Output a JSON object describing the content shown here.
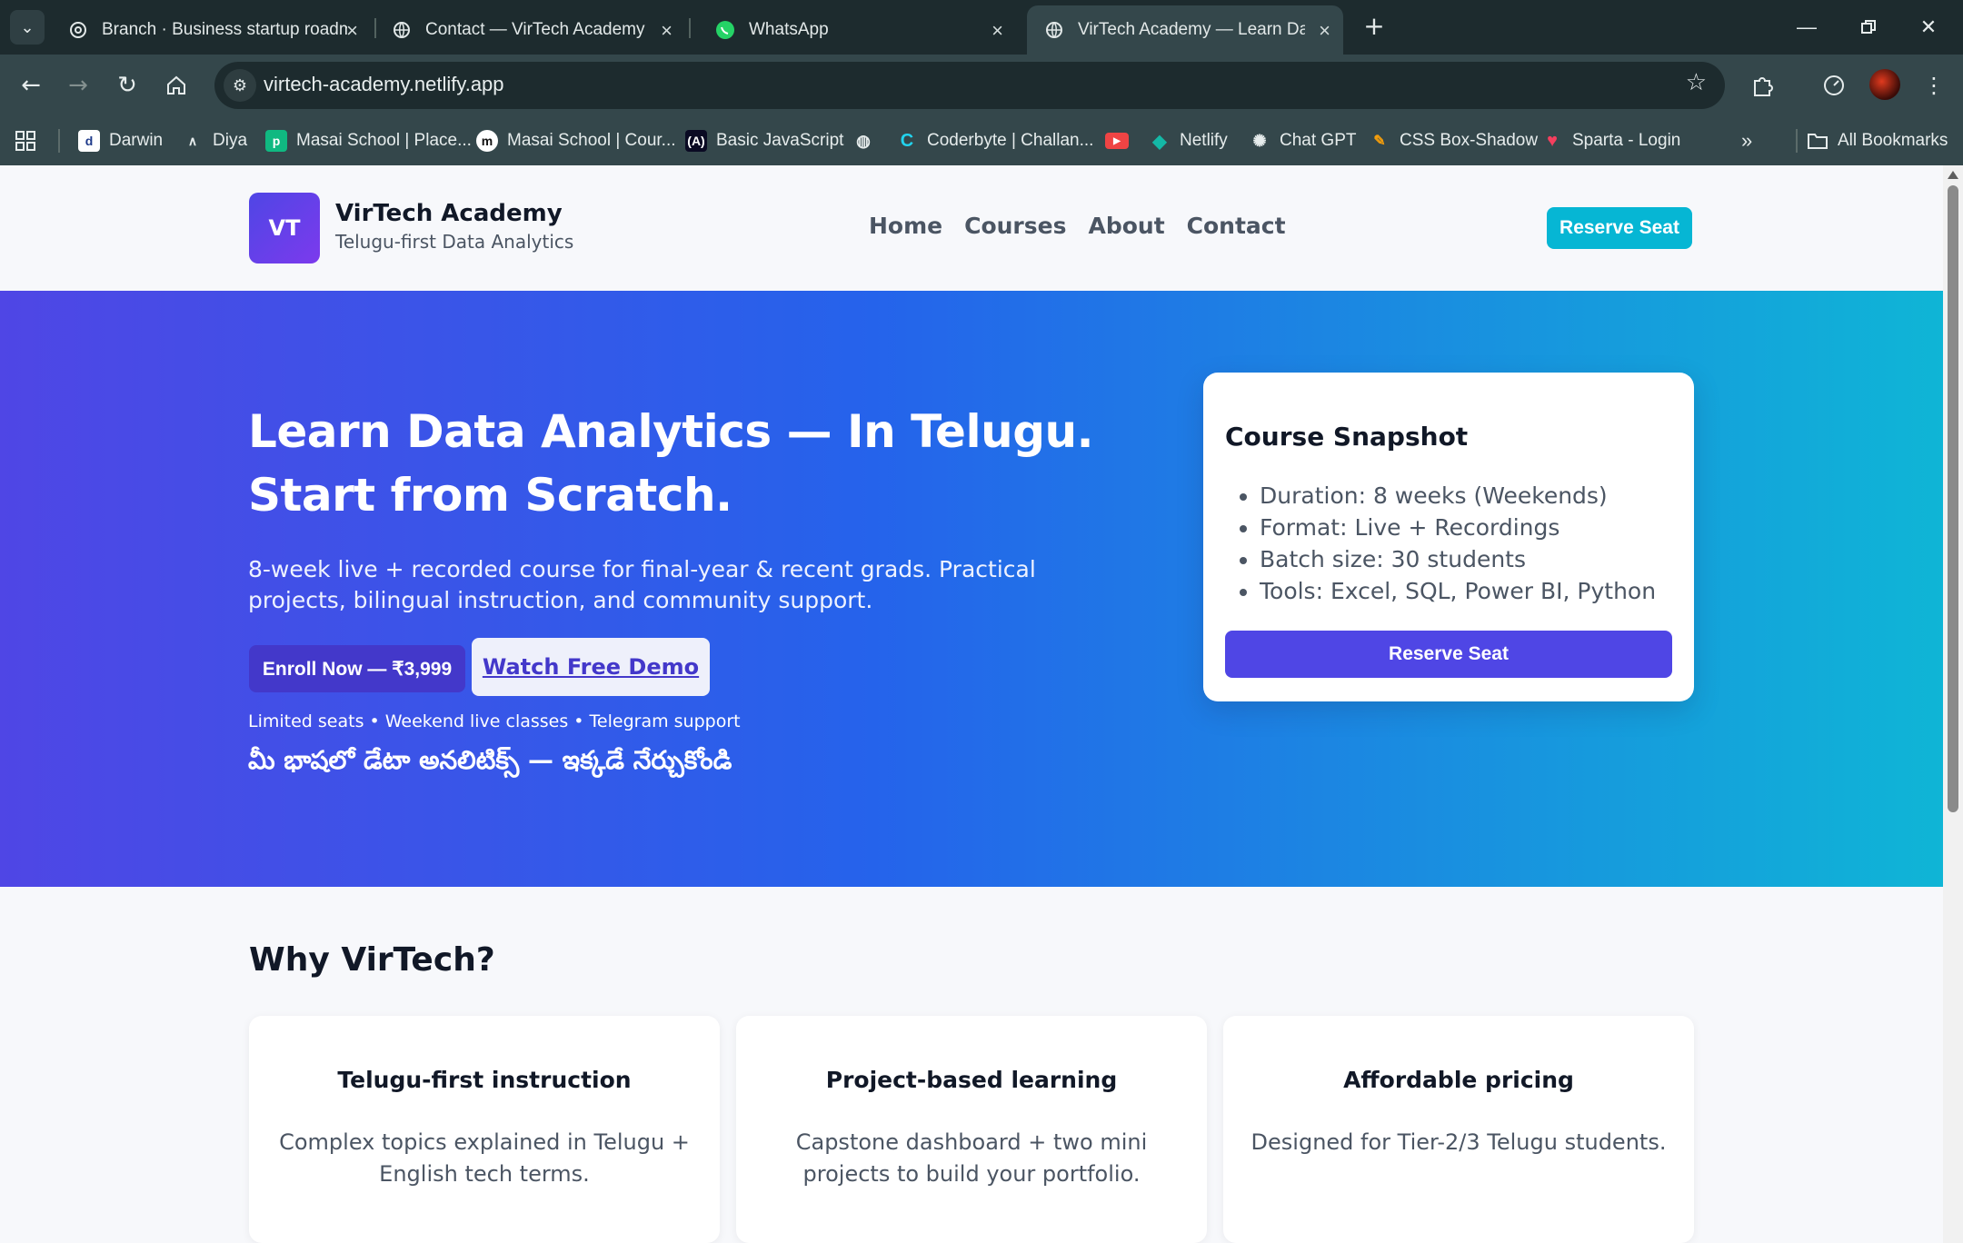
{
  "browser": {
    "tabs": [
      {
        "title": "Branch · Business startup roadm",
        "icon": "openai-icon"
      },
      {
        "title": "Contact — VirTech Academy",
        "icon": "globe-icon"
      },
      {
        "title": "WhatsApp",
        "icon": "whatsapp-icon"
      },
      {
        "title": "VirTech Academy — Learn Data",
        "icon": "globe-icon",
        "active": true
      }
    ],
    "url": "virtech-academy.netlify.app",
    "bookmarks": [
      {
        "label": "Darwin",
        "icon": "darwin-icon"
      },
      {
        "label": "Diya",
        "icon": "diya-icon"
      },
      {
        "label": "Masai School | Place...",
        "icon": "masai-p-icon"
      },
      {
        "label": "Masai School | Cour...",
        "icon": "masai-m-icon"
      },
      {
        "label": "Basic JavaScript",
        "icon": "fcc-icon"
      },
      {
        "label": "",
        "icon": "globe-icon"
      },
      {
        "label": "Coderbyte | Challan...",
        "icon": "coderbyte-icon"
      },
      {
        "label": "",
        "icon": "youtube-icon"
      },
      {
        "label": "Netlify",
        "icon": "netlify-icon"
      },
      {
        "label": "Chat GPT",
        "icon": "openai-icon"
      },
      {
        "label": "CSS Box-Shadow",
        "icon": "boxshadow-icon"
      },
      {
        "label": "Sparta - Login",
        "icon": "heart-icon"
      }
    ],
    "all_bookmarks": "All Bookmarks"
  },
  "site": {
    "logo": "VT",
    "name": "VirTech Academy",
    "tagline": "Telugu-first Data Analytics",
    "nav": [
      "Home",
      "Courses",
      "About",
      "Contact"
    ],
    "cta": "Reserve Seat"
  },
  "hero": {
    "title": "Learn Data Analytics — In Telugu. Start from Scratch.",
    "subtitle": "8-week live + recorded course for final-year & recent grads. Practical projects, bilingual instruction, and community support.",
    "enroll": "Enroll Now — ₹3,999",
    "demo": "Watch Free Demo",
    "note": "Limited seats • Weekend live classes • Telegram support",
    "telugu": "మీ భాషలో డేటా అనలిటిక్స్ — ఇక్కడే నేర్చుకోండి"
  },
  "snapshot": {
    "title": "Course Snapshot",
    "items": [
      "Duration: 8 weeks (Weekends)",
      "Format: Live + Recordings",
      "Batch size: 30 students",
      "Tools: Excel, SQL, Power BI, Python"
    ],
    "button": "Reserve Seat"
  },
  "why": {
    "title": "Why VirTech?",
    "features": [
      {
        "title": "Telugu-first instruction",
        "text": "Complex topics explained in Telugu + English tech terms."
      },
      {
        "title": "Project-based learning",
        "text": "Capstone dashboard + two mini projects to build your portfolio."
      },
      {
        "title": "Affordable pricing",
        "text": "Designed for Tier-2/3 Telugu students."
      }
    ]
  },
  "colors": {
    "primary": "#4f46e5",
    "accent": "#06b6d4",
    "hero_gradient_start": "#4f46e5",
    "hero_gradient_end": "#0fb5d6"
  }
}
